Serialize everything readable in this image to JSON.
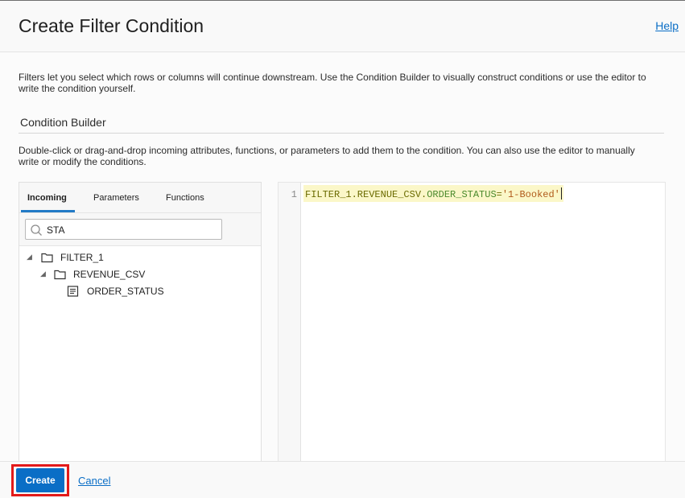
{
  "dialog": {
    "title": "Create Filter Condition",
    "help_label": "Help"
  },
  "intro": {
    "text": "Filters let you select which rows or columns will continue downstream. Use the Condition Builder to visually construct conditions or use the editor to write the condition yourself."
  },
  "condition_builder": {
    "title": "Condition Builder",
    "instructions": "Double-click or drag-and-drop incoming attributes, functions, or parameters to add them to the condition. You can also use the editor to manually write or modify the conditions."
  },
  "tabs": [
    {
      "label": "Incoming",
      "active": true
    },
    {
      "label": "Parameters",
      "active": false
    },
    {
      "label": "Functions",
      "active": false
    }
  ],
  "search": {
    "value": "STA",
    "icon": "search-icon"
  },
  "tree": {
    "nodes": [
      {
        "label": "FILTER_1",
        "icon": "folder-icon",
        "expanded": true,
        "level": 0
      },
      {
        "label": "REVENUE_CSV",
        "icon": "folder-icon",
        "expanded": true,
        "level": 1
      },
      {
        "label": "ORDER_STATUS",
        "icon": "attribute-icon",
        "level": 2
      }
    ]
  },
  "editor": {
    "line_number": "1",
    "code": {
      "entity": "FILTER_1.REVENUE_CSV.",
      "attribute": "ORDER_STATUS",
      "operator": "=",
      "value": "'1-Booked'"
    }
  },
  "footer": {
    "create_label": "Create",
    "cancel_label": "Cancel",
    "highlight_color": "#e31a1a"
  },
  "colors": {
    "accent": "#0a6ec6",
    "active_tab": "#227ac6",
    "code_highlight": "#fbf7c8"
  }
}
